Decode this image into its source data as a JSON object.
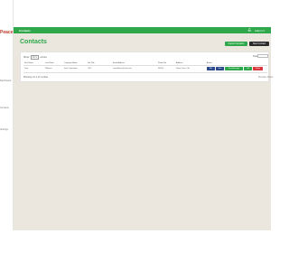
{
  "brand": {
    "text": "Peace",
    "mark": "✓"
  },
  "sidebar": {
    "items": [
      {
        "label": "Dashboard"
      },
      {
        "label": "Contacts"
      },
      {
        "label": "Settings"
      }
    ]
  },
  "topbar": {
    "title": "Contacts",
    "user": "Admin ▾",
    "bell_icon": "bell-icon"
  },
  "page": {
    "title": "Contacts",
    "import_label": "Import Contacts",
    "new_label": "New Contact"
  },
  "table": {
    "length_prefix": "Show",
    "length_value": "10 ▾",
    "length_suffix": "entries",
    "search_label": "Search:",
    "columns": [
      "First Name",
      "Last Name",
      "Company Name",
      "Job Title",
      "Email Address",
      "Phone No",
      "Address",
      "Action"
    ],
    "rows": [
      [
        "Sam",
        "Williams",
        "Intel Corporation",
        "CEO",
        "samwilliams@intel.com",
        "98345...",
        "Santa Clara, CA"
      ]
    ],
    "actions": [
      {
        "label": "Edit",
        "color": "#2b4a8c"
      },
      {
        "label": "View",
        "color": "#2b4a8c"
      },
      {
        "label": "Send Message",
        "color": "#2ea84a"
      },
      {
        "label": "Call",
        "color": "#2ea84a"
      },
      {
        "label": "Delete",
        "color": "#d9363e"
      }
    ],
    "info": "Showing 1 to 1 of 1 entries",
    "pager": "Previous  1  Next"
  },
  "colors": {
    "accent": "#2ea84a",
    "dark": "#2b2b2b",
    "background": "#ebe7df"
  }
}
